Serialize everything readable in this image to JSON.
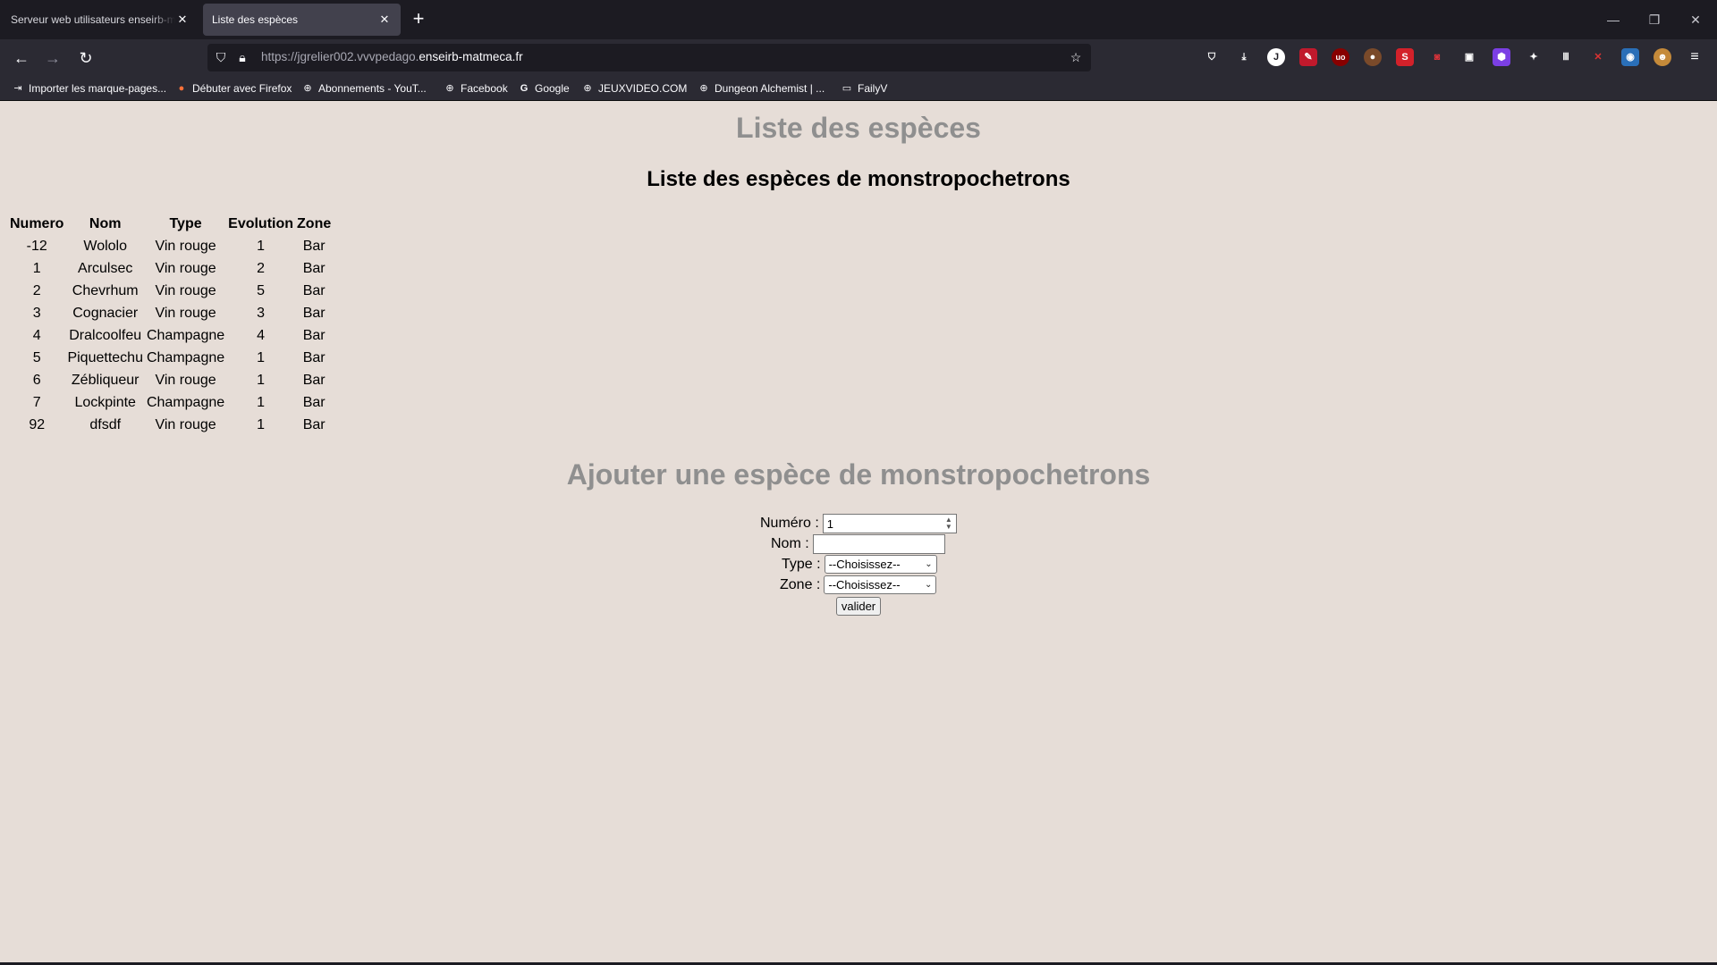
{
  "browser": {
    "tabs": [
      {
        "title": "Serveur web utilisateurs enseirb-matmeca",
        "active": false
      },
      {
        "title": "Liste des espèces",
        "active": true
      }
    ],
    "url": {
      "prefix": "https://jgrelier002.vvvpedago.",
      "domain": "enseirb-matmeca.fr"
    },
    "bookmarks": [
      {
        "label": "Importer les marque-pages...",
        "icon": "import-icon"
      },
      {
        "label": "Débuter avec Firefox",
        "icon": "firefox-icon"
      },
      {
        "label": "Abonnements - YouT...",
        "icon": "globe-icon"
      },
      {
        "label": "Facebook",
        "icon": "globe-icon"
      },
      {
        "label": "Google",
        "icon": "google-icon"
      },
      {
        "label": "JEUXVIDEO.COM",
        "icon": "globe-icon"
      },
      {
        "label": "Dungeon Alchemist | ...",
        "icon": "globe-icon"
      },
      {
        "label": "FailyV",
        "icon": "folder-icon"
      }
    ]
  },
  "page": {
    "title": "Liste des espèces",
    "list_heading": "Liste des espèces de monstropochetrons",
    "table": {
      "headers": [
        "Numero",
        "Nom",
        "Type",
        "Evolution",
        "Zone"
      ],
      "rows": [
        [
          "-12",
          "Wololo",
          "Vin rouge",
          "1",
          "Bar"
        ],
        [
          "1",
          "Arculsec",
          "Vin rouge",
          "2",
          "Bar"
        ],
        [
          "2",
          "Chevrhum",
          "Vin rouge",
          "5",
          "Bar"
        ],
        [
          "3",
          "Cognacier",
          "Vin rouge",
          "3",
          "Bar"
        ],
        [
          "4",
          "Dralcoolfeu",
          "Champagne",
          "4",
          "Bar"
        ],
        [
          "5",
          "Piquettechu",
          "Champagne",
          "1",
          "Bar"
        ],
        [
          "6",
          "Zébliqueur",
          "Vin rouge",
          "1",
          "Bar"
        ],
        [
          "7",
          "Lockpinte",
          "Champagne",
          "1",
          "Bar"
        ],
        [
          "92",
          "dfsdf",
          "Vin rouge",
          "1",
          "Bar"
        ]
      ]
    },
    "form": {
      "heading": "Ajouter une espèce de monstropochetrons",
      "numero_label": "Numéro :",
      "numero_value": "1",
      "nom_label": "Nom :",
      "nom_value": "",
      "type_label": "Type :",
      "type_selected": "--Choisissez--",
      "zone_label": "Zone :",
      "zone_selected": "--Choisissez--",
      "submit_label": "valider"
    }
  }
}
